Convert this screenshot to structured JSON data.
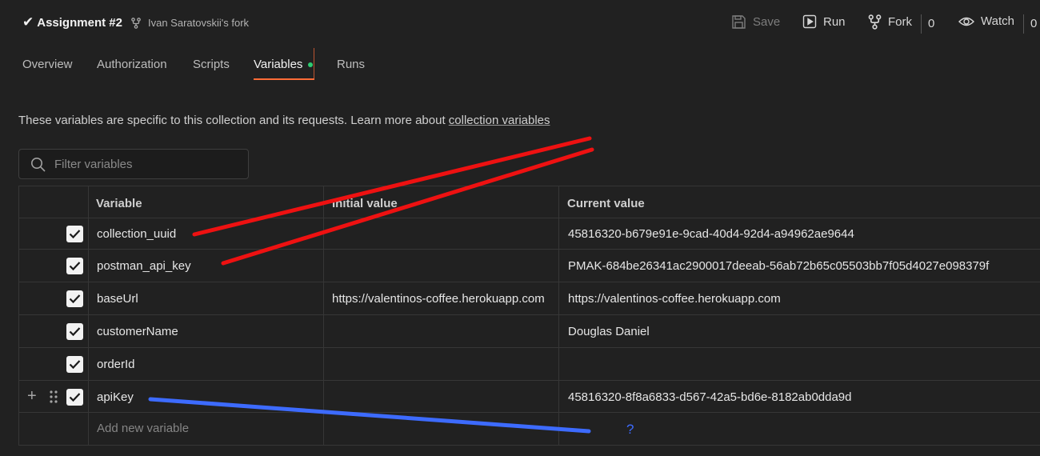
{
  "header": {
    "title": "Assignment #2",
    "fork_label": "Ivan Saratovskii's fork",
    "save_label": "Save",
    "run_label": "Run",
    "fork_button_label": "Fork",
    "fork_count": "0",
    "watch_label": "Watch",
    "watch_count": "0"
  },
  "tabs": [
    {
      "label": "Overview"
    },
    {
      "label": "Authorization"
    },
    {
      "label": "Scripts"
    },
    {
      "label": "Variables",
      "active": true
    },
    {
      "label": "Runs"
    }
  ],
  "description": {
    "text": "These variables are specific to this collection and its requests. Learn more about ",
    "link": "collection variables"
  },
  "filter": {
    "placeholder": "Filter variables",
    "value": ""
  },
  "table": {
    "headers": {
      "variable": "Variable",
      "initial": "Initial value",
      "current": "Current value"
    },
    "rows": [
      {
        "checked": true,
        "variable": "collection_uuid",
        "initial": "",
        "current": "45816320-b679e91e-9cad-40d4-92d4-a94962ae9644"
      },
      {
        "checked": true,
        "variable": "postman_api_key",
        "initial": "",
        "current": "PMAK-684be26341ac2900017deeab-56ab72b65c05503bb7f05d4027e098379f"
      },
      {
        "checked": true,
        "variable": "baseUrl",
        "initial": "https://valentinos-coffee.herokuapp.com",
        "current": "https://valentinos-coffee.herokuapp.com"
      },
      {
        "checked": true,
        "variable": "customerName",
        "initial": "",
        "current": "Douglas Daniel"
      },
      {
        "checked": true,
        "variable": "orderId",
        "initial": "",
        "current": ""
      },
      {
        "checked": true,
        "variable": "apiKey",
        "initial": "",
        "current": "45816320-8f8a6833-d567-42a5-bd6e-8182ab0dda9d"
      }
    ],
    "add_placeholder": "Add new variable"
  },
  "annotation": {
    "question_mark": "?"
  },
  "colors": {
    "accent": "#ff6c37",
    "dot": "#2ecc71",
    "annotation_red": "#ee1111",
    "annotation_blue": "#3d6bff"
  }
}
